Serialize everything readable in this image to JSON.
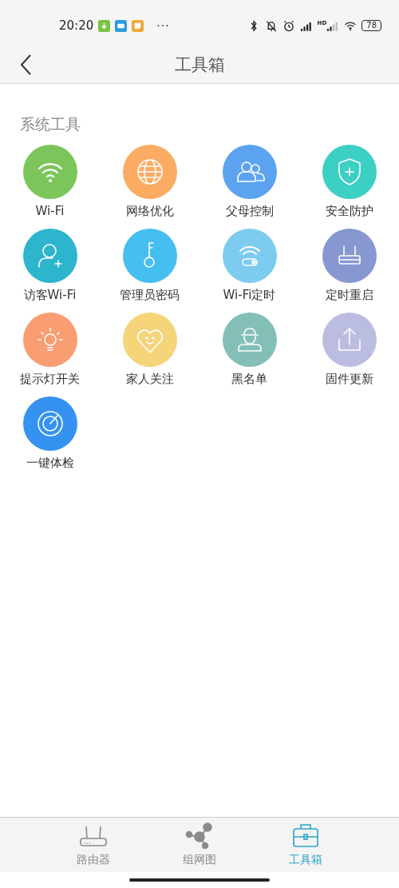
{
  "status_bar": {
    "time": "20:20",
    "notifications": [
      {
        "kind": "download",
        "color": "#7cc242"
      },
      {
        "kind": "mail",
        "color": "#2f9be0"
      },
      {
        "kind": "note",
        "color": "#f3a83b"
      }
    ],
    "more": "···",
    "signal_label": "HD",
    "battery": "78"
  },
  "header": {
    "title": "工具箱"
  },
  "section": {
    "title": "系统工具",
    "tools": [
      {
        "kind": "wifi",
        "label": "Wi-Fi",
        "color": "#7cc55a"
      },
      {
        "kind": "globe",
        "label": "网络优化",
        "color": "#fbab62"
      },
      {
        "kind": "people",
        "label": "父母控制",
        "color": "#5ba3ef"
      },
      {
        "kind": "shield",
        "label": "安全防护",
        "color": "#3ccfc3"
      },
      {
        "kind": "guest",
        "label": "访客Wi-Fi",
        "color": "#2cb5cc"
      },
      {
        "kind": "key",
        "label": "管理员密码",
        "color": "#44bff0"
      },
      {
        "kind": "wifi_timer",
        "label": "Wi-Fi定时",
        "color": "#7ecbf0"
      },
      {
        "kind": "router",
        "label": "定时重启",
        "color": "#8797cf"
      },
      {
        "kind": "bulb",
        "label": "提示灯开关",
        "color": "#f99d72"
      },
      {
        "kind": "heart",
        "label": "家人关注",
        "color": "#f5d47a"
      },
      {
        "kind": "hat",
        "label": "黑名单",
        "color": "#84bfb7"
      },
      {
        "kind": "upload",
        "label": "固件更新",
        "color": "#bbbde0"
      },
      {
        "kind": "radar",
        "label": "一键体检",
        "color": "#3592f0"
      }
    ]
  },
  "tab_bar": [
    {
      "kind": "router",
      "label": "路由器",
      "selected": false
    },
    {
      "kind": "network",
      "label": "组网图",
      "selected": false
    },
    {
      "kind": "toolbox",
      "label": "工具箱",
      "selected": true
    }
  ]
}
